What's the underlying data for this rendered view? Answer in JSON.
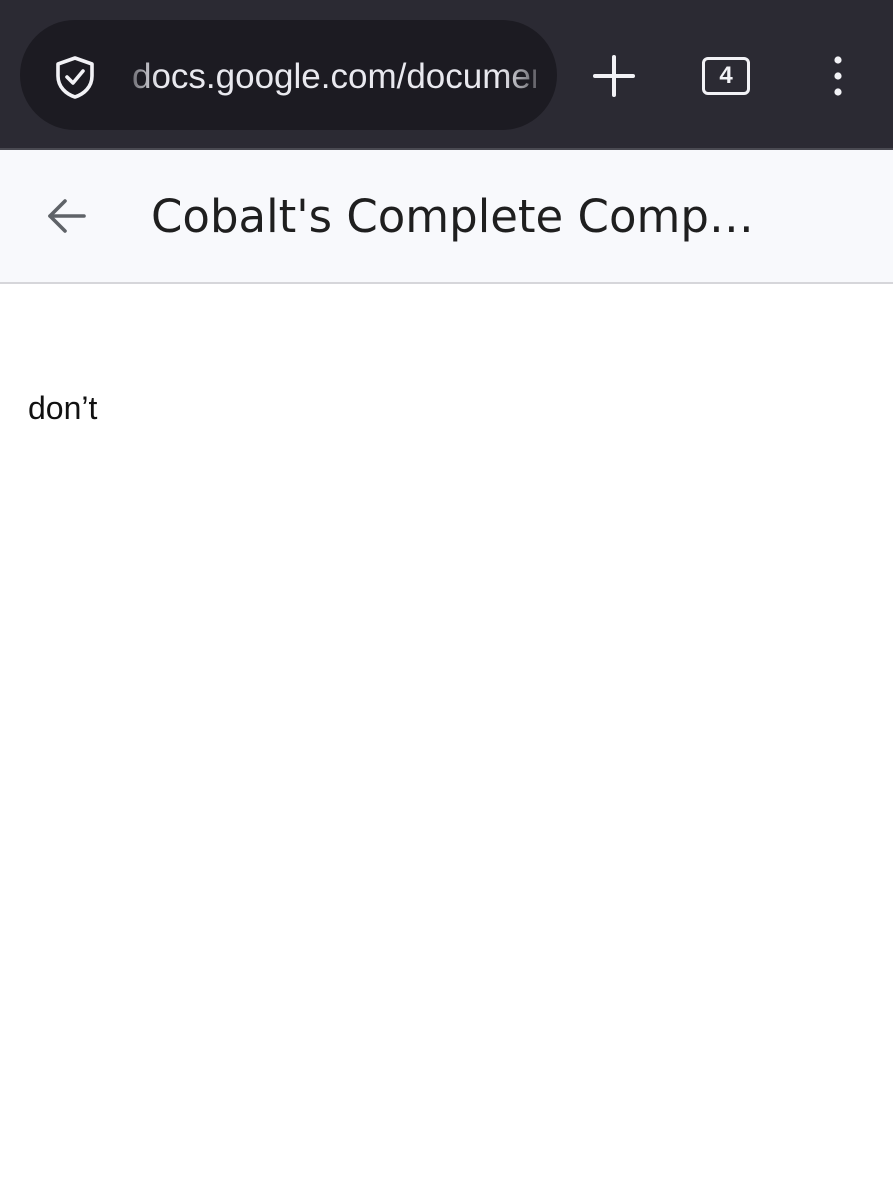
{
  "browser": {
    "url": "docs.google.com/document",
    "tab_count": "4",
    "icons": {
      "security": "shield-check-icon",
      "new_tab": "plus-icon",
      "tabs": "tab-switcher-icon",
      "menu": "kebab-menu-icon"
    },
    "colors": {
      "toolbar": "#2b2a33",
      "url_pill": "#1c1b22",
      "icon": "#f2f2f6"
    }
  },
  "doc_header": {
    "back_icon": "arrow-left-icon",
    "title": "Cobalt's Complete Comp…"
  },
  "document": {
    "text": "don’t"
  }
}
